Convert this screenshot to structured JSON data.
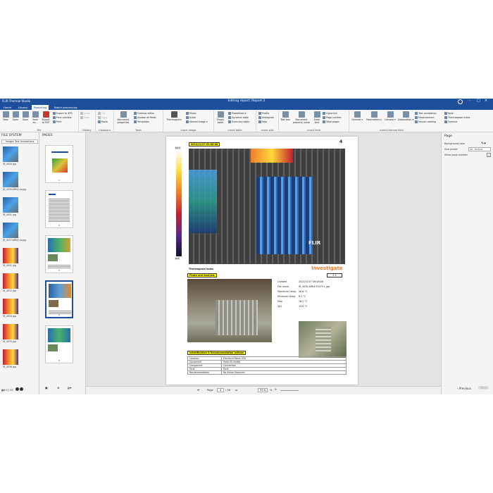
{
  "app": {
    "title": "FLIR Thermal Studio",
    "document_title": "Editing report: Report 2"
  },
  "menu": {
    "tabs": [
      "Home",
      "Library",
      "Reporting",
      "Batch processing"
    ],
    "active": "Reporting"
  },
  "ribbon": {
    "file": {
      "label": "File",
      "new": "New",
      "open": "Open",
      "save": "Save",
      "save_as": "Save as...",
      "export_pdf": "Export to PDF",
      "export_xps": "Export to XPS",
      "print_preview": "Print preview",
      "print": "Print"
    },
    "history": {
      "label": "History",
      "undo": "Undo",
      "redo": "Redo"
    },
    "clipboard": {
      "label": "Clipboard",
      "cut": "Cut",
      "copy": "Copy",
      "paste": "Paste"
    },
    "tools": {
      "label": "Tools",
      "document_properties": "Document properties",
      "formula_editor": "Formula editor",
      "update_all_fields": "Update all fields",
      "templates": "Templates"
    },
    "insert_image": {
      "label": "Insert image",
      "thermogram": "Thermogram",
      "photo": "Photo",
      "scale": "Scale",
      "shared_image": "Shared image"
    },
    "insert_table": {
      "label": "Insert table",
      "empty_table": "Empty table",
      "predefined": "Predefined",
      "dynamic_table": "Dynamic table",
      "summary_table": "Summary table"
    },
    "insert_plot": {
      "label": "Insert plot",
      "profile": "Profile",
      "histogram": "Histogram",
      "map": "Map"
    },
    "insert_field": {
      "label": "Insert field",
      "text_box": "Text box",
      "document_property_value": "Document property value",
      "date_text": "Date text",
      "hyperlink": "Hyperlink",
      "page_number": "Page number",
      "total_pages": "Total pages"
    },
    "insert_thermal_field": {
      "label": "Insert thermal field",
      "general": "General",
      "parameters": "Parameters",
      "camera": "Camera",
      "geolocation": "Geolocation",
      "text_annotation": "Text annotation",
      "measurement": "Measurement",
      "sensor_reading": "Sensor reading",
      "note": "Note",
      "thermogram_index": "Thermogram index",
      "formula": "Formula"
    }
  },
  "file_system": {
    "title": "FILE SYSTEM",
    "search": "Images Test Annotations",
    "items": [
      {
        "name": "IR_4030.jpg",
        "kind": "panel"
      },
      {
        "name": "IR_4030-ARK4-xx.jpg",
        "kind": "panel"
      },
      {
        "name": "IR_4031.jpg",
        "kind": "panel"
      },
      {
        "name": "IR_4037-ARK4-xx.jpg",
        "kind": "panel"
      },
      {
        "name": "IR_4031.jpg",
        "kind": "hot"
      },
      {
        "name": "IR_4032.jpg",
        "kind": "hot"
      },
      {
        "name": "IR_4034.jpg",
        "kind": "hot"
      },
      {
        "name": "IR_4035.jpg",
        "kind": "hot"
      },
      {
        "name": "IR_4036.jpg",
        "kind": "hot"
      }
    ],
    "counter": "0 / 22"
  },
  "pages": {
    "title": "PAGES",
    "items": [
      "1",
      "2",
      "3",
      "4",
      "5"
    ],
    "selected": "4"
  },
  "report": {
    "page_number": "4",
    "timestamp_label": "2012/11/27 09:08:08",
    "scale_top": "52.7",
    "scale_bottom": "8.9",
    "brand": "FLIR",
    "thermogram_index_label": "Thermogram index",
    "status_title": "Investigate",
    "status_value": "2.5",
    "photo_label": "Photo and Analysis",
    "fields": [
      {
        "key": "Created",
        "value": "2012/11/27 09:08:08"
      },
      {
        "key": "File name",
        "value": "IR_4030-ARK4-9107V-L.jpg"
      },
      {
        "key": "Maximum temp.",
        "value": "26.6 °C"
      },
      {
        "key": "Minimum temp.",
        "value": "8.2 °C"
      },
      {
        "key": "Max",
        "value": "16.2 °C"
      },
      {
        "key": "Sp1",
        "value": "13.8 °C"
      }
    ],
    "ident_label": "Identification & Recommendation actions",
    "ident_rows": [
      {
        "key": "Location",
        "value": "Electrical Room 318"
      },
      {
        "key": "Equipment",
        "value": "Panel ID 00466"
      },
      {
        "key": "Component",
        "value": "Connection"
      },
      {
        "key": "Fault",
        "value": "Fault"
      },
      {
        "key": "Recommendation",
        "value": "No Action Required"
      }
    ]
  },
  "statusbar": {
    "page_label": "Page",
    "current_page": "4",
    "total_pages": "/ 26",
    "zoom": "93.6",
    "zoom_unit": "%"
  },
  "right_panel": {
    "title": "Page",
    "background_color_label": "Background color",
    "size_preset_label": "Size preset",
    "size_preset_value": "A4 - Portrait",
    "show_page_number_label": "Show page number",
    "previous": "Previous",
    "next": "Next"
  },
  "colors": {
    "titlebar": "#1e4f9c",
    "accent_orange": "#f07d2a",
    "label_yellow": "#ffff00"
  }
}
